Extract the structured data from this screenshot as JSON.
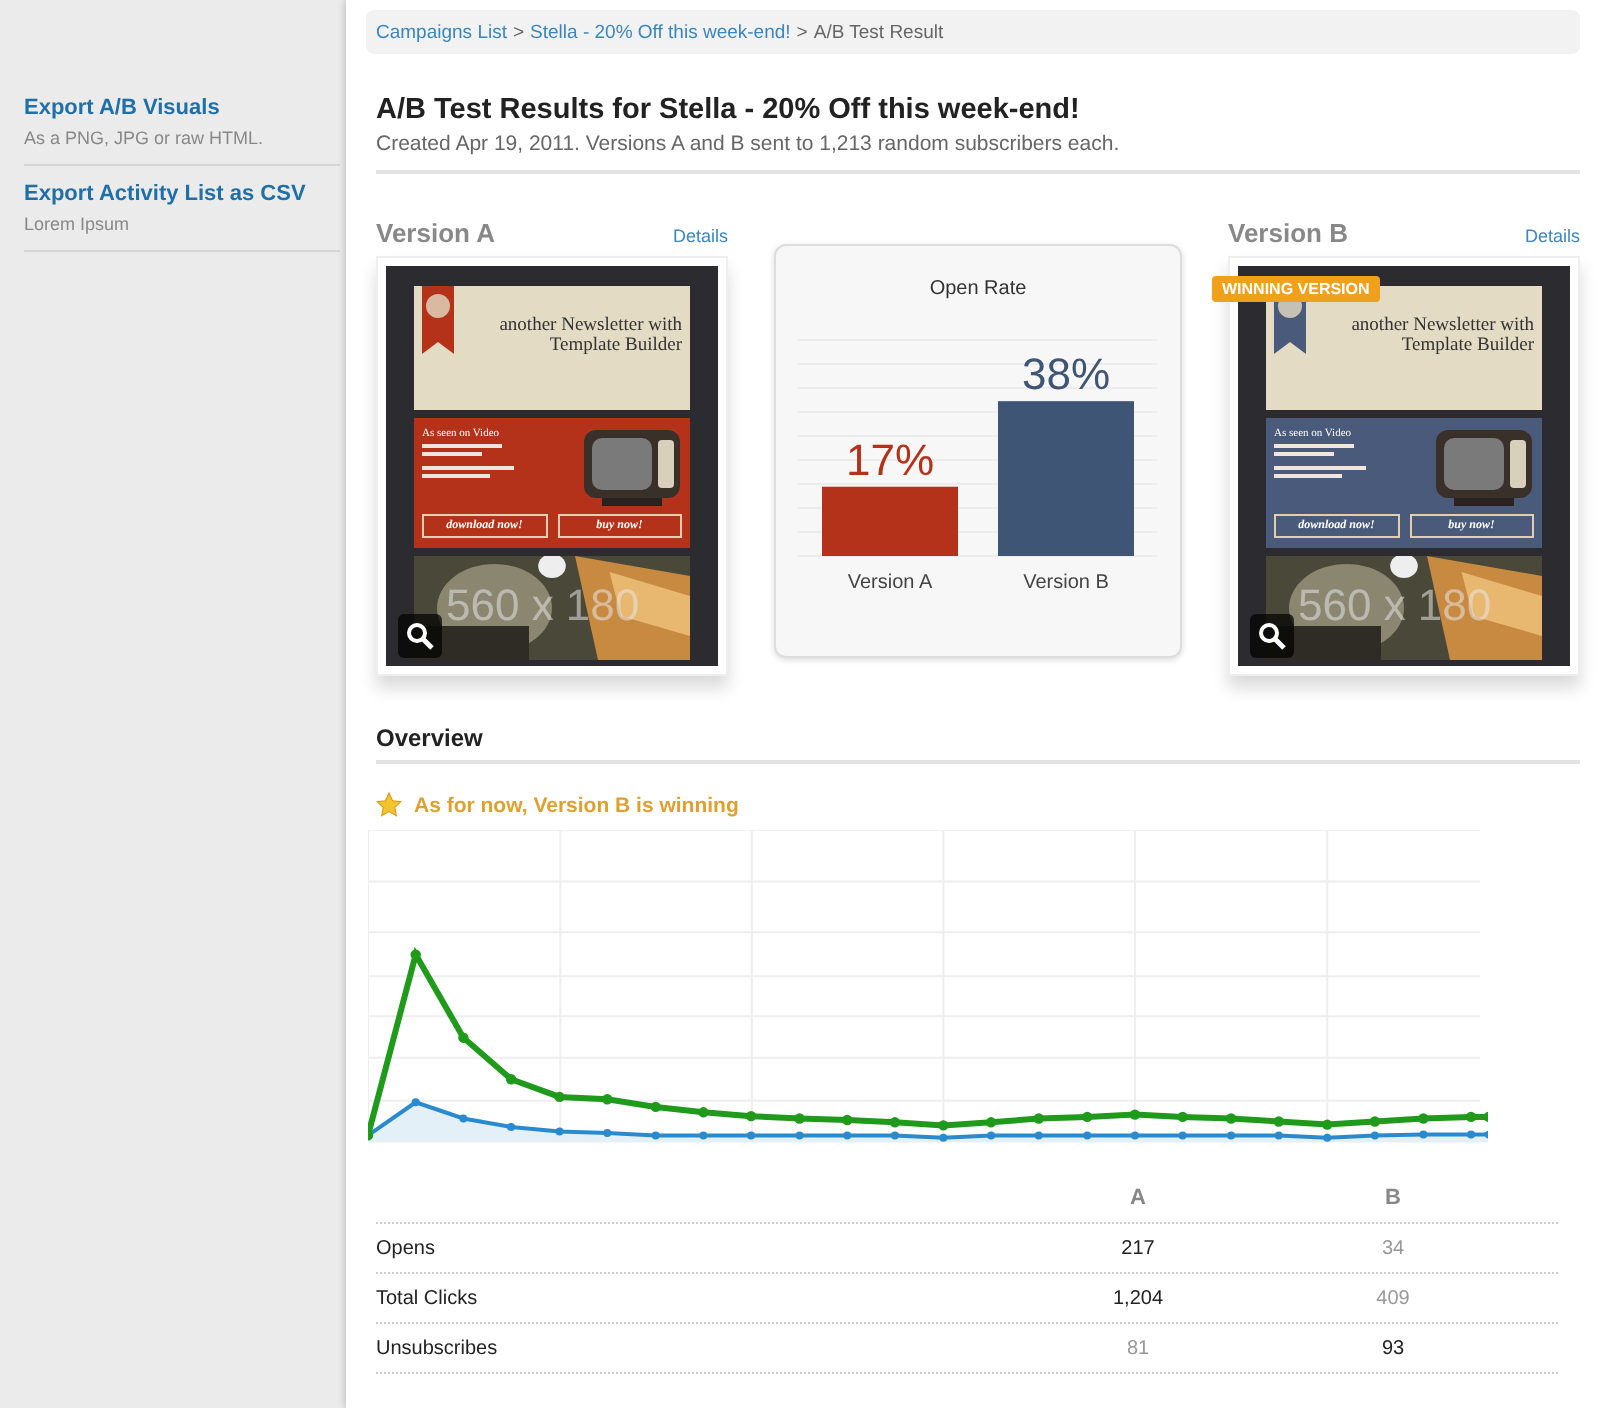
{
  "sidebar": {
    "items": [
      {
        "title": "Export A/B Visuals",
        "description": "As a PNG, JPG or raw HTML."
      },
      {
        "title": "Export Activity List as CSV",
        "description": "Lorem Ipsum"
      }
    ]
  },
  "breadcrumb": {
    "links": [
      "Campaigns List",
      "Stella - 20% Off this week-end!"
    ],
    "separator": ">",
    "current": "A/B Test Result"
  },
  "title": "A/B Test Results for Stella - 20% Off this week-end!",
  "subtitle": "Created Apr 19, 2011. Versions A and B sent to 1,213 random subscribers each.",
  "versions": [
    {
      "name": "Version A",
      "details": "Details",
      "color": "#b5321a",
      "preview": {
        "headline": "another Newsletter with Template Builder",
        "section": "As seen on Video",
        "buttons": [
          "download now!",
          "buy now!"
        ],
        "image_label": "560 x 180"
      }
    },
    {
      "name": "Version B",
      "details": "Details",
      "color": "#4a5a7a",
      "badge": "WINNING VERSION",
      "preview": {
        "headline": "another Newsletter with Template Builder",
        "section": "As seen on Video",
        "buttons": [
          "download now!",
          "buy now!"
        ],
        "image_label": "560 x 180"
      }
    }
  ],
  "open_rate": {
    "chart_data": {
      "type": "bar",
      "title": "Open Rate",
      "categories": [
        "Version A",
        "Version B"
      ],
      "values": [
        17,
        38
      ],
      "value_labels": [
        "17%",
        "38%"
      ]
    }
  },
  "overview": {
    "title": "Overview",
    "status": "As for now, Version B is winning"
  },
  "table": {
    "columns": [
      "A",
      "B"
    ],
    "rows": [
      {
        "label": "Opens",
        "cells": [
          {
            "value": "217",
            "leading": true
          },
          {
            "value": "34",
            "leading": false
          }
        ]
      },
      {
        "label": "Total Clicks",
        "cells": [
          {
            "value": "1,204",
            "leading": true
          },
          {
            "value": "409",
            "leading": false
          }
        ]
      },
      {
        "label": "Unsubscribes",
        "cells": [
          {
            "value": "81",
            "leading": false
          },
          {
            "value": "93",
            "leading": true
          }
        ]
      }
    ]
  }
}
